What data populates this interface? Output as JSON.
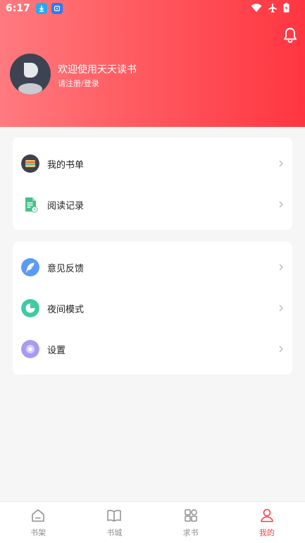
{
  "status_bar": {
    "time": "6:17"
  },
  "profile": {
    "welcome_text": "欢迎使用天天读书",
    "login_text": "请注册/登录"
  },
  "menu_group_1": [
    {
      "label": "我的书单",
      "icon": "booklist-icon"
    },
    {
      "label": "阅读记录",
      "icon": "reading-record-icon"
    }
  ],
  "menu_group_2": [
    {
      "label": "意见反馈",
      "icon": "feedback-icon"
    },
    {
      "label": "夜间模式",
      "icon": "night-mode-icon"
    },
    {
      "label": "设置",
      "icon": "settings-icon"
    }
  ],
  "tabs": [
    {
      "label": "书架",
      "icon": "bookshelf-icon",
      "active": false
    },
    {
      "label": "书城",
      "icon": "bookstore-icon",
      "active": false
    },
    {
      "label": "求书",
      "icon": "request-book-icon",
      "active": false
    },
    {
      "label": "我的",
      "icon": "profile-icon",
      "active": true
    }
  ],
  "colors": {
    "accent": "#ff3a44",
    "header_start": "#ff7a7f",
    "header_end": "#ff3641"
  }
}
